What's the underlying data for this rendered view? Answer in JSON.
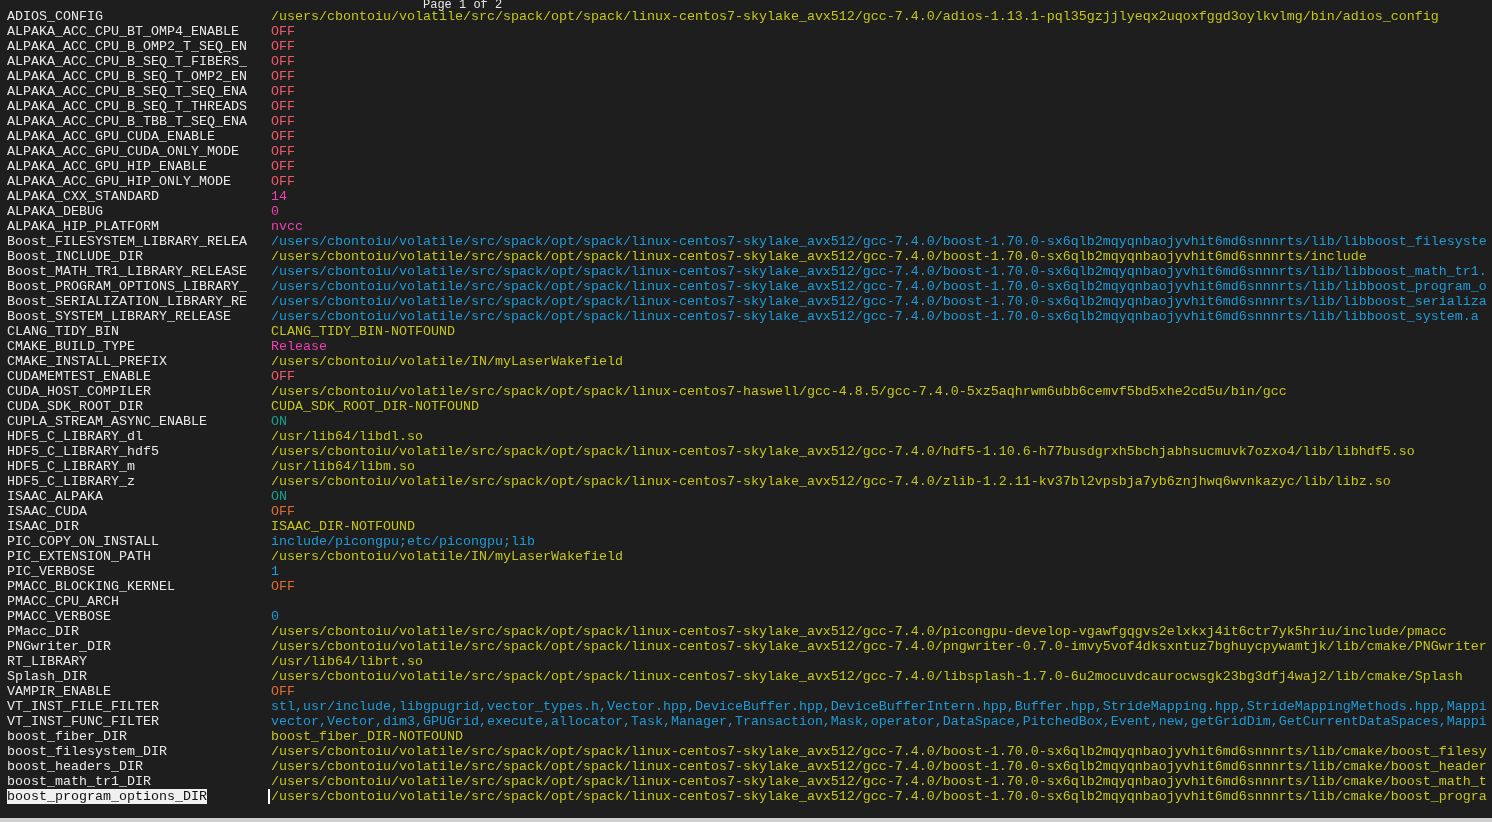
{
  "header": "Page 1 of 2",
  "entries": [
    {
      "name": "ADIOS_CONFIG",
      "value": "/users/cbontoiu/volatile/src/spack/opt/spack/linux-centos7-skylake_avx512/gcc-7.4.0/adios-1.13.1-pql35gzjjlyeqx2uqoxfggd3oylkvlmg/bin/adios_config",
      "color": "#c5c51c",
      "selected": false
    },
    {
      "name": "ALPAKA_ACC_CPU_BT_OMP4_ENABLE",
      "value": "OFF",
      "color": "#f0586a",
      "selected": false
    },
    {
      "name": "ALPAKA_ACC_CPU_B_OMP2_T_SEQ_EN",
      "value": "OFF",
      "color": "#f0586a",
      "selected": false
    },
    {
      "name": "ALPAKA_ACC_CPU_B_SEQ_T_FIBERS_",
      "value": "OFF",
      "color": "#f0586a",
      "selected": false
    },
    {
      "name": "ALPAKA_ACC_CPU_B_SEQ_T_OMP2_EN",
      "value": "OFF",
      "color": "#f0586a",
      "selected": false
    },
    {
      "name": "ALPAKA_ACC_CPU_B_SEQ_T_SEQ_ENA",
      "value": "OFF",
      "color": "#f0586a",
      "selected": false
    },
    {
      "name": "ALPAKA_ACC_CPU_B_SEQ_T_THREADS",
      "value": "OFF",
      "color": "#f0586a",
      "selected": false
    },
    {
      "name": "ALPAKA_ACC_CPU_B_TBB_T_SEQ_ENA",
      "value": "OFF",
      "color": "#f0586a",
      "selected": false
    },
    {
      "name": "ALPAKA_ACC_GPU_CUDA_ENABLE",
      "value": "OFF",
      "color": "#f0586a",
      "selected": false
    },
    {
      "name": "ALPAKA_ACC_GPU_CUDA_ONLY_MODE",
      "value": "OFF",
      "color": "#f0586a",
      "selected": false
    },
    {
      "name": "ALPAKA_ACC_GPU_HIP_ENABLE",
      "value": "OFF",
      "color": "#f0586a",
      "selected": false
    },
    {
      "name": "ALPAKA_ACC_GPU_HIP_ONLY_MODE",
      "value": "OFF",
      "color": "#f0586a",
      "selected": false
    },
    {
      "name": "ALPAKA_CXX_STANDARD",
      "value": "14",
      "color": "#f040b0",
      "selected": false
    },
    {
      "name": "ALPAKA_DEBUG",
      "value": "0",
      "color": "#f040b0",
      "selected": false
    },
    {
      "name": "ALPAKA_HIP_PLATFORM",
      "value": "nvcc",
      "color": "#f040b0",
      "selected": false
    },
    {
      "name": "Boost_FILESYSTEM_LIBRARY_RELEA",
      "value": "/users/cbontoiu/volatile/src/spack/opt/spack/linux-centos7-skylake_avx512/gcc-7.4.0/boost-1.70.0-sx6qlb2mqyqnbaojyvhit6md6snnnrts/lib/libboost_filesyste",
      "color": "#1e9ad6",
      "selected": false
    },
    {
      "name": "Boost_INCLUDE_DIR",
      "value": "/users/cbontoiu/volatile/src/spack/opt/spack/linux-centos7-skylake_avx512/gcc-7.4.0/boost-1.70.0-sx6qlb2mqyqnbaojyvhit6md6snnnrts/include",
      "color": "#c5c51c",
      "selected": false
    },
    {
      "name": "Boost_MATH_TR1_LIBRARY_RELEASE",
      "value": "/users/cbontoiu/volatile/src/spack/opt/spack/linux-centos7-skylake_avx512/gcc-7.4.0/boost-1.70.0-sx6qlb2mqyqnbaojyvhit6md6snnnrts/lib/libboost_math_tr1.",
      "color": "#1e9ad6",
      "selected": false
    },
    {
      "name": "Boost_PROGRAM_OPTIONS_LIBRARY_",
      "value": "/users/cbontoiu/volatile/src/spack/opt/spack/linux-centos7-skylake_avx512/gcc-7.4.0/boost-1.70.0-sx6qlb2mqyqnbaojyvhit6md6snnnrts/lib/libboost_program_o",
      "color": "#1e9ad6",
      "selected": false
    },
    {
      "name": "Boost_SERIALIZATION_LIBRARY_RE",
      "value": "/users/cbontoiu/volatile/src/spack/opt/spack/linux-centos7-skylake_avx512/gcc-7.4.0/boost-1.70.0-sx6qlb2mqyqnbaojyvhit6md6snnnrts/lib/libboost_serializa",
      "color": "#1e9ad6",
      "selected": false
    },
    {
      "name": "Boost_SYSTEM_LIBRARY_RELEASE",
      "value": "/users/cbontoiu/volatile/src/spack/opt/spack/linux-centos7-skylake_avx512/gcc-7.4.0/boost-1.70.0-sx6qlb2mqyqnbaojyvhit6md6snnnrts/lib/libboost_system.a",
      "color": "#1e9ad6",
      "selected": false
    },
    {
      "name": "CLANG_TIDY_BIN",
      "value": "CLANG_TIDY_BIN-NOTFOUND",
      "color": "#c5c51c",
      "selected": false
    },
    {
      "name": "CMAKE_BUILD_TYPE",
      "value": "Release",
      "color": "#f040b0",
      "selected": false
    },
    {
      "name": "CMAKE_INSTALL_PREFIX",
      "value": "/users/cbontoiu/volatile/IN/myLaserWakefield",
      "color": "#c5c51c",
      "selected": false
    },
    {
      "name": "CUDAMEMTEST_ENABLE",
      "value": "OFF",
      "color": "#f0586a",
      "selected": false
    },
    {
      "name": "CUDA_HOST_COMPILER",
      "value": "/users/cbontoiu/volatile/src/spack/opt/spack/linux-centos7-haswell/gcc-4.8.5/gcc-7.4.0-5xz5aqhrwm6ubb6cemvf5bd5xhe2cd5u/bin/gcc",
      "color": "#c5c51c",
      "selected": false
    },
    {
      "name": "CUDA_SDK_ROOT_DIR",
      "value": "CUDA_SDK_ROOT_DIR-NOTFOUND",
      "color": "#c5c51c",
      "selected": false
    },
    {
      "name": "CUPLA_STREAM_ASYNC_ENABLE",
      "value": "ON",
      "color": "#14a08c",
      "selected": false
    },
    {
      "name": "HDF5_C_LIBRARY_dl",
      "value": "/usr/lib64/libdl.so",
      "color": "#c5c51c",
      "selected": false
    },
    {
      "name": "HDF5_C_LIBRARY_hdf5",
      "value": "/users/cbontoiu/volatile/src/spack/opt/spack/linux-centos7-skylake_avx512/gcc-7.4.0/hdf5-1.10.6-h77busdgrxh5bchjabhsucmuvk7ozxo4/lib/libhdf5.so",
      "color": "#c5c51c",
      "selected": false
    },
    {
      "name": "HDF5_C_LIBRARY_m",
      "value": "/usr/lib64/libm.so",
      "color": "#c5c51c",
      "selected": false
    },
    {
      "name": "HDF5_C_LIBRARY_z",
      "value": "/users/cbontoiu/volatile/src/spack/opt/spack/linux-centos7-skylake_avx512/gcc-7.4.0/zlib-1.2.11-kv37bl2vpsbja7yb6znjhwq6wvnkazyc/lib/libz.so",
      "color": "#c5c51c",
      "selected": false
    },
    {
      "name": "ISAAC_ALPAKA",
      "value": "ON",
      "color": "#14a08c",
      "selected": false
    },
    {
      "name": "ISAAC_CUDA",
      "value": "OFF",
      "color": "#e06c30",
      "selected": false
    },
    {
      "name": "ISAAC_DIR",
      "value": "ISAAC_DIR-NOTFOUND",
      "color": "#c5c51c",
      "selected": false
    },
    {
      "name": "PIC_COPY_ON_INSTALL",
      "value": "include/picongpu;etc/picongpu;lib",
      "color": "#1e9ad6",
      "selected": false
    },
    {
      "name": "PIC_EXTENSION_PATH",
      "value": "/users/cbontoiu/volatile/IN/myLaserWakefield",
      "color": "#c5c51c",
      "selected": false
    },
    {
      "name": "PIC_VERBOSE",
      "value": "1",
      "color": "#1e9ad6",
      "selected": false
    },
    {
      "name": "PMACC_BLOCKING_KERNEL",
      "value": "OFF",
      "color": "#e06c30",
      "selected": false
    },
    {
      "name": "PMACC_CPU_ARCH",
      "selected": false
    },
    {
      "name": "PMACC_VERBOSE",
      "value": "0",
      "color": "#1e9ad6",
      "selected": false
    },
    {
      "name": "PMacc_DIR",
      "value": "/users/cbontoiu/volatile/src/spack/opt/spack/linux-centos7-skylake_avx512/gcc-7.4.0/picongpu-develop-vgawfgqgvs2elxkxj4it6ctr7yk5hriu/include/pmacc",
      "color": "#c5c51c",
      "selected": false
    },
    {
      "name": "PNGwriter_DIR",
      "value": "/users/cbontoiu/volatile/src/spack/opt/spack/linux-centos7-skylake_avx512/gcc-7.4.0/pngwriter-0.7.0-imvy5vof4dksxntuz7bghuycpywamtjk/lib/cmake/PNGwriter",
      "color": "#c5c51c",
      "selected": false
    },
    {
      "name": "RT_LIBRARY",
      "value": "/usr/lib64/librt.so",
      "color": "#c5c51c",
      "selected": false
    },
    {
      "name": "Splash_DIR",
      "value": "/users/cbontoiu/volatile/src/spack/opt/spack/linux-centos7-skylake_avx512/gcc-7.4.0/libsplash-1.7.0-6u2mocuvdcaurocwsgk23bg3dfj4waj2/lib/cmake/Splash",
      "color": "#c5c51c",
      "selected": false
    },
    {
      "name": "VAMPIR_ENABLE",
      "value": "OFF",
      "color": "#e06c30",
      "selected": false
    },
    {
      "name": "VT_INST_FILE_FILTER",
      "value": "stl,usr/include,libgpugrid,vector_types.h,Vector.hpp,DeviceBuffer.hpp,DeviceBufferIntern.hpp,Buffer.hpp,StrideMapping.hpp,StrideMappingMethods.hpp,Mappi",
      "color": "#1e9ad6",
      "selected": false
    },
    {
      "name": "VT_INST_FUNC_FILTER",
      "value": "vector,Vector,dim3,GPUGrid,execute,allocator,Task,Manager,Transaction,Mask,operator,DataSpace,PitchedBox,Event,new,getGridDim,GetCurrentDataSpaces,Mappi",
      "color": "#1e9ad6",
      "selected": false
    },
    {
      "name": "boost_fiber_DIR",
      "value": "boost_fiber_DIR-NOTFOUND",
      "color": "#c5c51c",
      "selected": false
    },
    {
      "name": "boost_filesystem_DIR",
      "value": "/users/cbontoiu/volatile/src/spack/opt/spack/linux-centos7-skylake_avx512/gcc-7.4.0/boost-1.70.0-sx6qlb2mqyqnbaojyvhit6md6snnnrts/lib/cmake/boost_filesy",
      "color": "#c5c51c",
      "selected": false
    },
    {
      "name": "boost_headers_DIR",
      "value": "/users/cbontoiu/volatile/src/spack/opt/spack/linux-centos7-skylake_avx512/gcc-7.4.0/boost-1.70.0-sx6qlb2mqyqnbaojyvhit6md6snnnrts/lib/cmake/boost_header",
      "color": "#c5c51c",
      "selected": false
    },
    {
      "name": "boost_math_tr1_DIR",
      "value": "/users/cbontoiu/volatile/src/spack/opt/spack/linux-centos7-skylake_avx512/gcc-7.4.0/boost-1.70.0-sx6qlb2mqyqnbaojyvhit6md6snnnrts/lib/cmake/boost_math_t",
      "color": "#c5c51c",
      "selected": false
    },
    {
      "name": "boost_program_options_DIR",
      "value": "/users/cbontoiu/volatile/src/spack/opt/spack/linux-centos7-skylake_avx512/gcc-7.4.0/boost-1.70.0-sx6qlb2mqyqnbaojyvhit6md6snnnrts/lib/cmake/boost_progra",
      "color": "#c5c51c",
      "selected": true
    }
  ]
}
